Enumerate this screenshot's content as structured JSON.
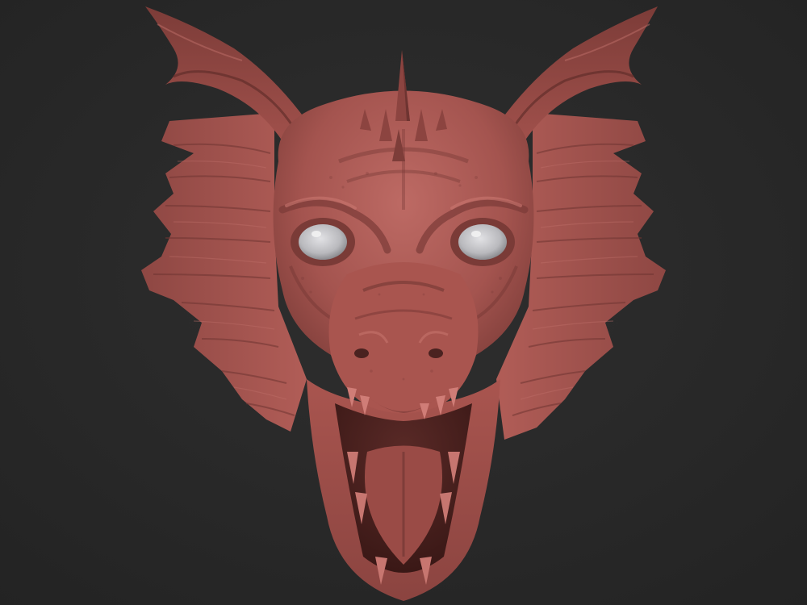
{
  "scene": {
    "subject_icon": "dragon-head-sculpt-icon",
    "colors": {
      "background": "#262626",
      "background_center": "#2e2e2e",
      "clay_base": "#a4544f",
      "clay_light": "#c4706a",
      "clay_dark": "#6e3431",
      "clay_deep": "#4a2220",
      "eye": "#c9c9cc",
      "eye_highlight": "#f2f2f2"
    }
  }
}
